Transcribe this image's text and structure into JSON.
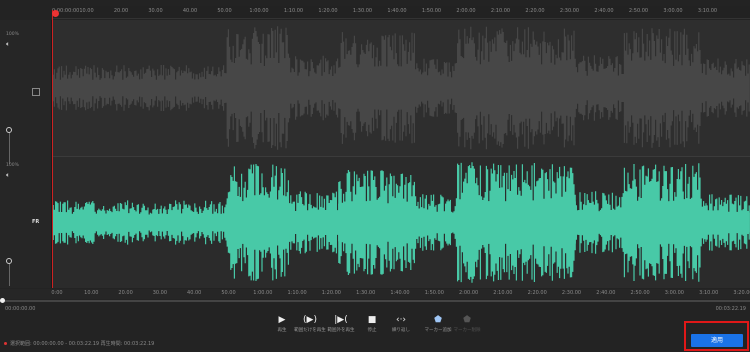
{
  "ruler_top": {
    "start": "0:00:00:00",
    "ticks": [
      "10.00",
      "20.00",
      "30.00",
      "40.00",
      "50.00",
      "1:00.00",
      "1:10.00",
      "1:20.00",
      "1:30.00",
      "1:40.00",
      "1:50.00",
      "2:00.00",
      "2:10.00",
      "2:20.00",
      "2:30.00",
      "2:40.00",
      "2:50.00",
      "3:00.00",
      "3:10.00"
    ]
  },
  "ruler_bottom": {
    "ticks": [
      "0:00",
      "10.00",
      "20.00",
      "30.00",
      "40.00",
      "50.00",
      "1:00.00",
      "1:10.00",
      "1:20.00",
      "1:30.00",
      "1:40.00",
      "1:50.00",
      "2:00.00",
      "2:10.00",
      "2:20.00",
      "2:30.00",
      "2:40.00",
      "2:50.00",
      "3:00.00",
      "3:10.00",
      "3:20.00"
    ]
  },
  "gutter": {
    "top_level": "100%",
    "bottom_level": "100%",
    "channel_label": "FR",
    "top_volume": 0.4,
    "bottom_volume": 0.3
  },
  "timeline": {
    "current_time": "00:00:00.00",
    "total_time": "00:03:22.19"
  },
  "transport": [
    {
      "icon": "play-icon",
      "glyph": "▶",
      "label": "再生"
    },
    {
      "icon": "play-selection-icon",
      "glyph": "(▶)",
      "label": "範囲だけを再生"
    },
    {
      "icon": "play-outside-icon",
      "glyph": "|▶(",
      "label": "範囲外を再生"
    },
    {
      "icon": "stop-icon",
      "glyph": "■",
      "label": "停止"
    },
    {
      "icon": "loop-icon",
      "glyph": "‹·›",
      "label": "繰り返し"
    },
    {
      "icon": "add-marker-icon",
      "glyph": "⬟",
      "label": "マーカー追加"
    },
    {
      "icon": "remove-marker-icon",
      "glyph": "⬟",
      "label": "マーカー削除"
    }
  ],
  "status": {
    "text": "選択範囲: 00:00:00.00 - 00:03:22.19 再生時間: 00:03:22.19"
  },
  "apply_button": {
    "label": "適用"
  },
  "colors": {
    "waveform_selected": "#48c9a7",
    "waveform_unselected": "#474747",
    "playhead": "#e33333",
    "apply": "#1a73e8",
    "highlight_box": "#e01818"
  }
}
